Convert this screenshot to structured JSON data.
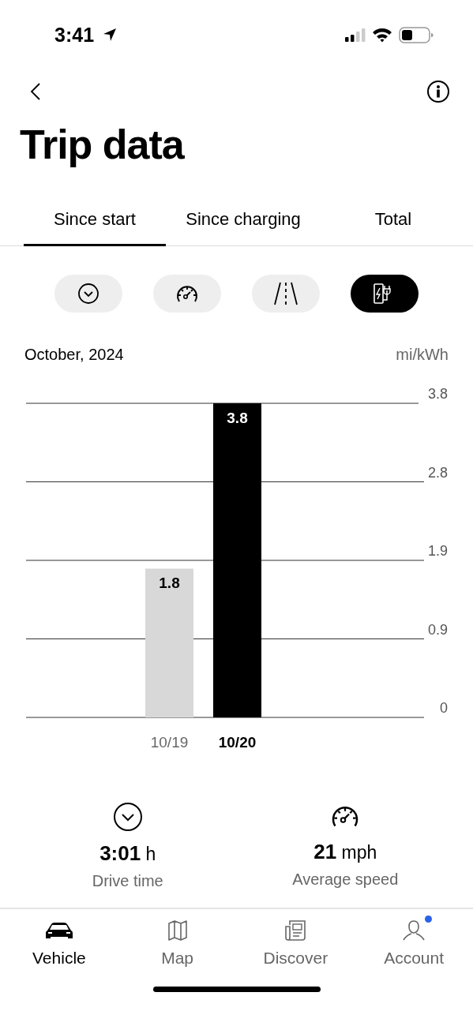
{
  "status_bar": {
    "time": "3:41"
  },
  "title": "Trip data",
  "tabs": [
    {
      "label": "Since start",
      "selected": true
    },
    {
      "label": "Since charging",
      "selected": false
    },
    {
      "label": "Total",
      "selected": false
    }
  ],
  "filters": [
    {
      "kind": "clock",
      "selected": false
    },
    {
      "kind": "gauge",
      "selected": false
    },
    {
      "kind": "road",
      "selected": false
    },
    {
      "kind": "charger",
      "selected": true
    }
  ],
  "chart": {
    "period": "October, 2024",
    "unit": "mi/kWh",
    "bars": [
      {
        "selected": false
      },
      {
        "selected": true
      }
    ],
    "chart_data": {
      "type": "bar",
      "categories": [
        "10/19",
        "10/20"
      ],
      "values": [
        1.8,
        3.8
      ],
      "ylim": [
        0,
        3.8
      ],
      "yticks": [
        0,
        {
          "value": 0.95,
          "label": "0.9"
        },
        1.9,
        {
          "value": 2.85,
          "label": "2.8"
        },
        3.8
      ],
      "grid": true,
      "data_labels": true
    }
  },
  "stats": [
    {
      "kind": "clock",
      "value": "3:01",
      "unit": "h",
      "label": "Drive time"
    },
    {
      "kind": "gauge",
      "value": "21",
      "unit": "mph",
      "label": "Average speed"
    }
  ],
  "bottom_nav": [
    {
      "kind": "car",
      "label": "Vehicle",
      "selected": true,
      "badge": false
    },
    {
      "kind": "map",
      "label": "Map",
      "selected": false,
      "badge": false
    },
    {
      "kind": "news",
      "label": "Discover",
      "selected": false,
      "badge": false
    },
    {
      "kind": "person",
      "label": "Account",
      "selected": false,
      "badge": true
    }
  ]
}
